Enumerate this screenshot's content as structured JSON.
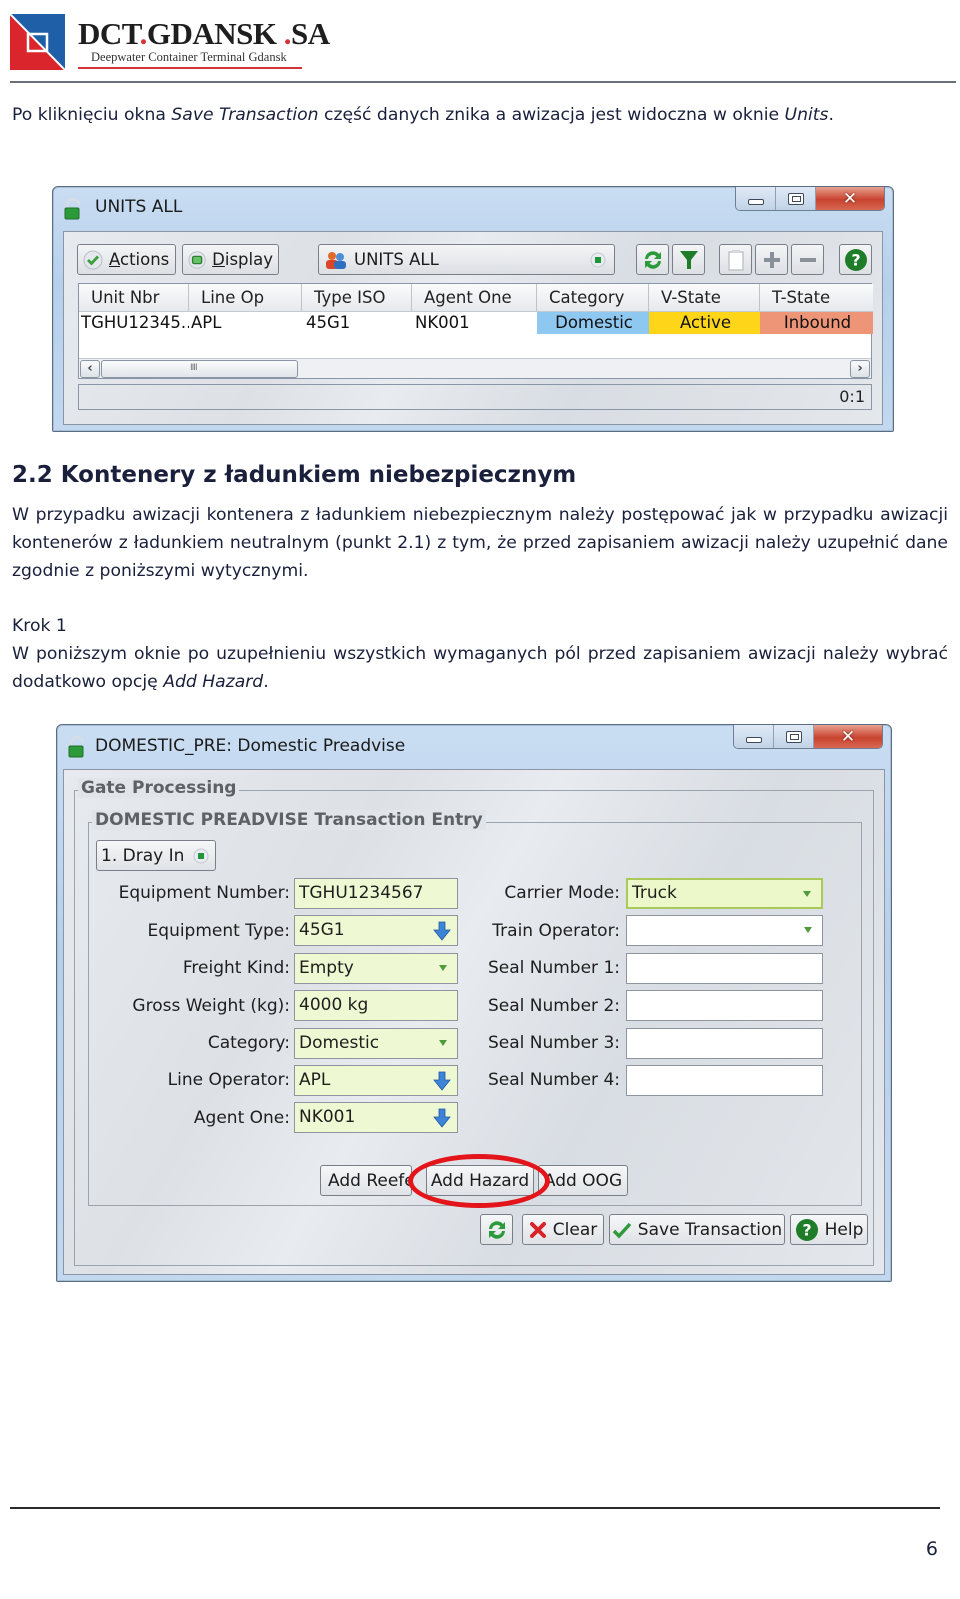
{
  "header": {
    "brand_part1": "DCT",
    "brand_dot1": ".",
    "brand_part2": "GDANSK",
    "brand_dot2": ".",
    "brand_part3": "SA",
    "subtitle": "Deepwater Container Terminal Gdansk",
    "colors": {
      "brand_red": "#d2343a",
      "brand_blue": "#1f5fa8"
    }
  },
  "intro": {
    "text_before": "Po kliknięciu okna ",
    "italic1": "Save Transaction",
    "text_middle": " część danych znika a awizacja jest widoczna w oknie ",
    "italic2": "Units",
    "text_after": "."
  },
  "units_window": {
    "title": "UNITS ALL",
    "window_controls": {
      "minimize": "minimize",
      "maximize": "maximize",
      "close": "close"
    },
    "toolbar": {
      "actions_label": "Actions",
      "actions_mnemonic": "A",
      "display_label": "Display",
      "display_mnemonic": "D",
      "view_selector": "UNITS ALL",
      "icons": [
        "refresh-icon",
        "filter-icon",
        "copy-icon",
        "add-icon",
        "remove-icon",
        "help-icon"
      ]
    },
    "table": {
      "columns": [
        "Unit Nbr",
        "Line Op",
        "Type ISO",
        "Agent One",
        "Category",
        "V-State",
        "T-State"
      ],
      "rows": [
        {
          "unit_nbr": "TGHU12345...",
          "line_op": "APL",
          "type_iso": "45G1",
          "agent_one": "NK001",
          "category": "Domestic",
          "v_state": "Active",
          "t_state": "Inbound"
        }
      ],
      "cell_colors": {
        "category": "#8ec8f0",
        "v_state": "#ffd51a",
        "t_state": "#ef9577"
      }
    },
    "status_count": "0:1"
  },
  "section": {
    "heading": "2.2  Kontenery z ładunkiem niebezpiecznym",
    "paragraph": "W przypadku awizacji kontenera z ładunkiem niebezpiecznym należy postępować jak w przypadku awizacji kontenerów z ładunkiem neutralnym (punkt 2.1) z tym, że przed zapisaniem awizacji należy uzupełnić dane zgodnie z poniższymi wytycznymi.",
    "step_title": "Krok 1",
    "step_text_before": "W poniższym oknie po uzupełnieniu wszystkich wymaganych pól przed zapisaniem awizacji należy wybrać dodatkowo opcję ",
    "step_italic": "Add Hazard",
    "step_text_after": "."
  },
  "preadvise_window": {
    "title": "DOMESTIC_PRE: Domestic Preadvise",
    "group_outer": "Gate Processing",
    "group_inner": "DOMESTIC PREADVISE Transaction Entry",
    "mode_selector": "1. Dray In",
    "left_fields": [
      {
        "label": "Equipment Number:",
        "value": "TGHU1234567",
        "kind": "text"
      },
      {
        "label": "Equipment Type:",
        "value": "45G1",
        "kind": "lookup"
      },
      {
        "label": "Freight Kind:",
        "value": "Empty",
        "kind": "dropdown"
      },
      {
        "label": "Gross Weight (kg):",
        "value": "4000 kg",
        "kind": "text"
      },
      {
        "label": "Category:",
        "value": "Domestic",
        "kind": "dropdown"
      },
      {
        "label": "Line Operator:",
        "value": "APL",
        "kind": "lookup"
      },
      {
        "label": "Agent One:",
        "value": "NK001",
        "kind": "lookup"
      }
    ],
    "right_fields": [
      {
        "label": "Carrier Mode:",
        "value": "Truck",
        "kind": "dropdown"
      },
      {
        "label": "Train Operator:",
        "value": "",
        "kind": "dropdown"
      },
      {
        "label": "Seal Number 1:",
        "value": "",
        "kind": "text"
      },
      {
        "label": "Seal Number 2:",
        "value": "",
        "kind": "text"
      },
      {
        "label": "Seal Number 3:",
        "value": "",
        "kind": "text"
      },
      {
        "label": "Seal Number 4:",
        "value": "",
        "kind": "text"
      }
    ],
    "option_buttons": {
      "add_reefer": "Add Reefe",
      "add_hazard": "Add Hazard",
      "add_oog": "Add OOG"
    },
    "action_buttons": {
      "clear": "Clear",
      "save": "Save Transaction",
      "help": "Help"
    },
    "highlight_color": "#e3151b"
  },
  "footer": {
    "page_number": "6"
  }
}
